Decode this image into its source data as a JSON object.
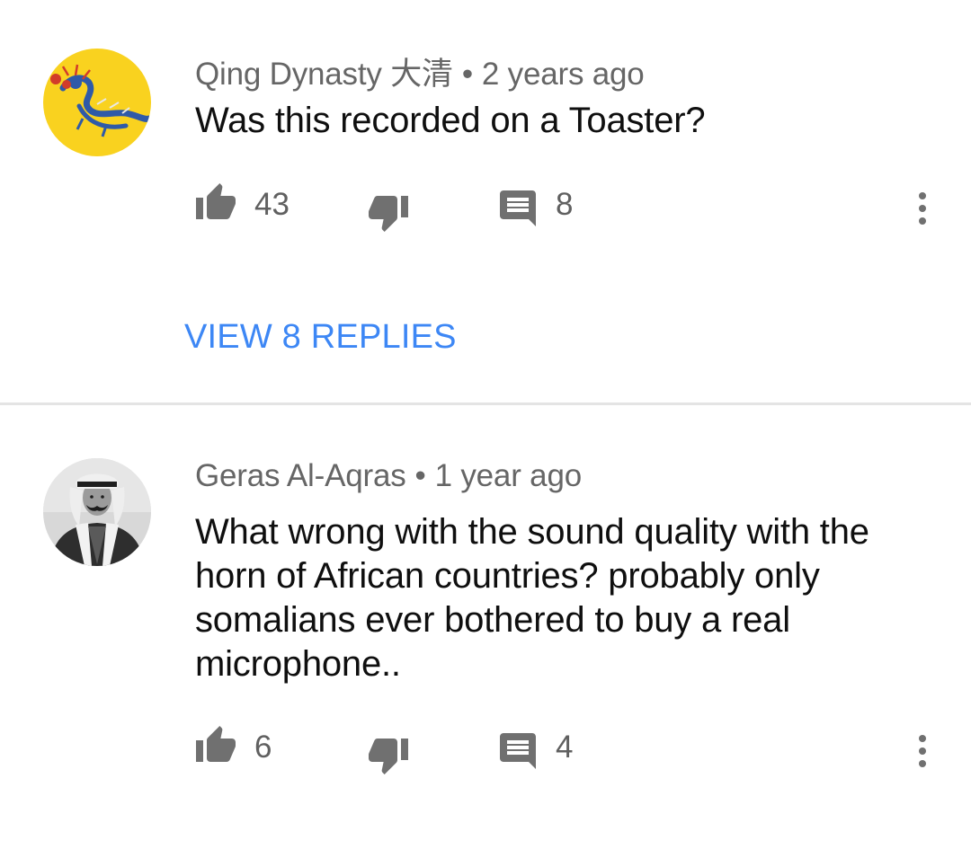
{
  "comments": [
    {
      "author": "Qing Dynasty 大清",
      "separator": "•",
      "time": "2 years ago",
      "text": "Was this recorded on a Toaster?",
      "likes": "43",
      "replies": "8",
      "view_replies_label": "VIEW 8 REPLIES",
      "avatar_icon": "dragon-flag-avatar",
      "avatar_color": "#f9d21f"
    },
    {
      "author": "Geras Al-Aqras",
      "separator": "•",
      "time": "1 year ago",
      "text": "What wrong with the sound quality with the horn of African countries? probably only somalians ever bothered to buy a real microphone..",
      "likes": "6",
      "replies": "4",
      "avatar_icon": "portrait-photo-avatar"
    }
  ],
  "icons": {
    "like": "thumbs-up-icon",
    "dislike": "thumbs-down-icon",
    "reply": "comment-icon",
    "more": "more-vert-icon"
  },
  "colors": {
    "link": "#3d87f5",
    "icon": "#707070",
    "divider": "#e4e4e4"
  }
}
